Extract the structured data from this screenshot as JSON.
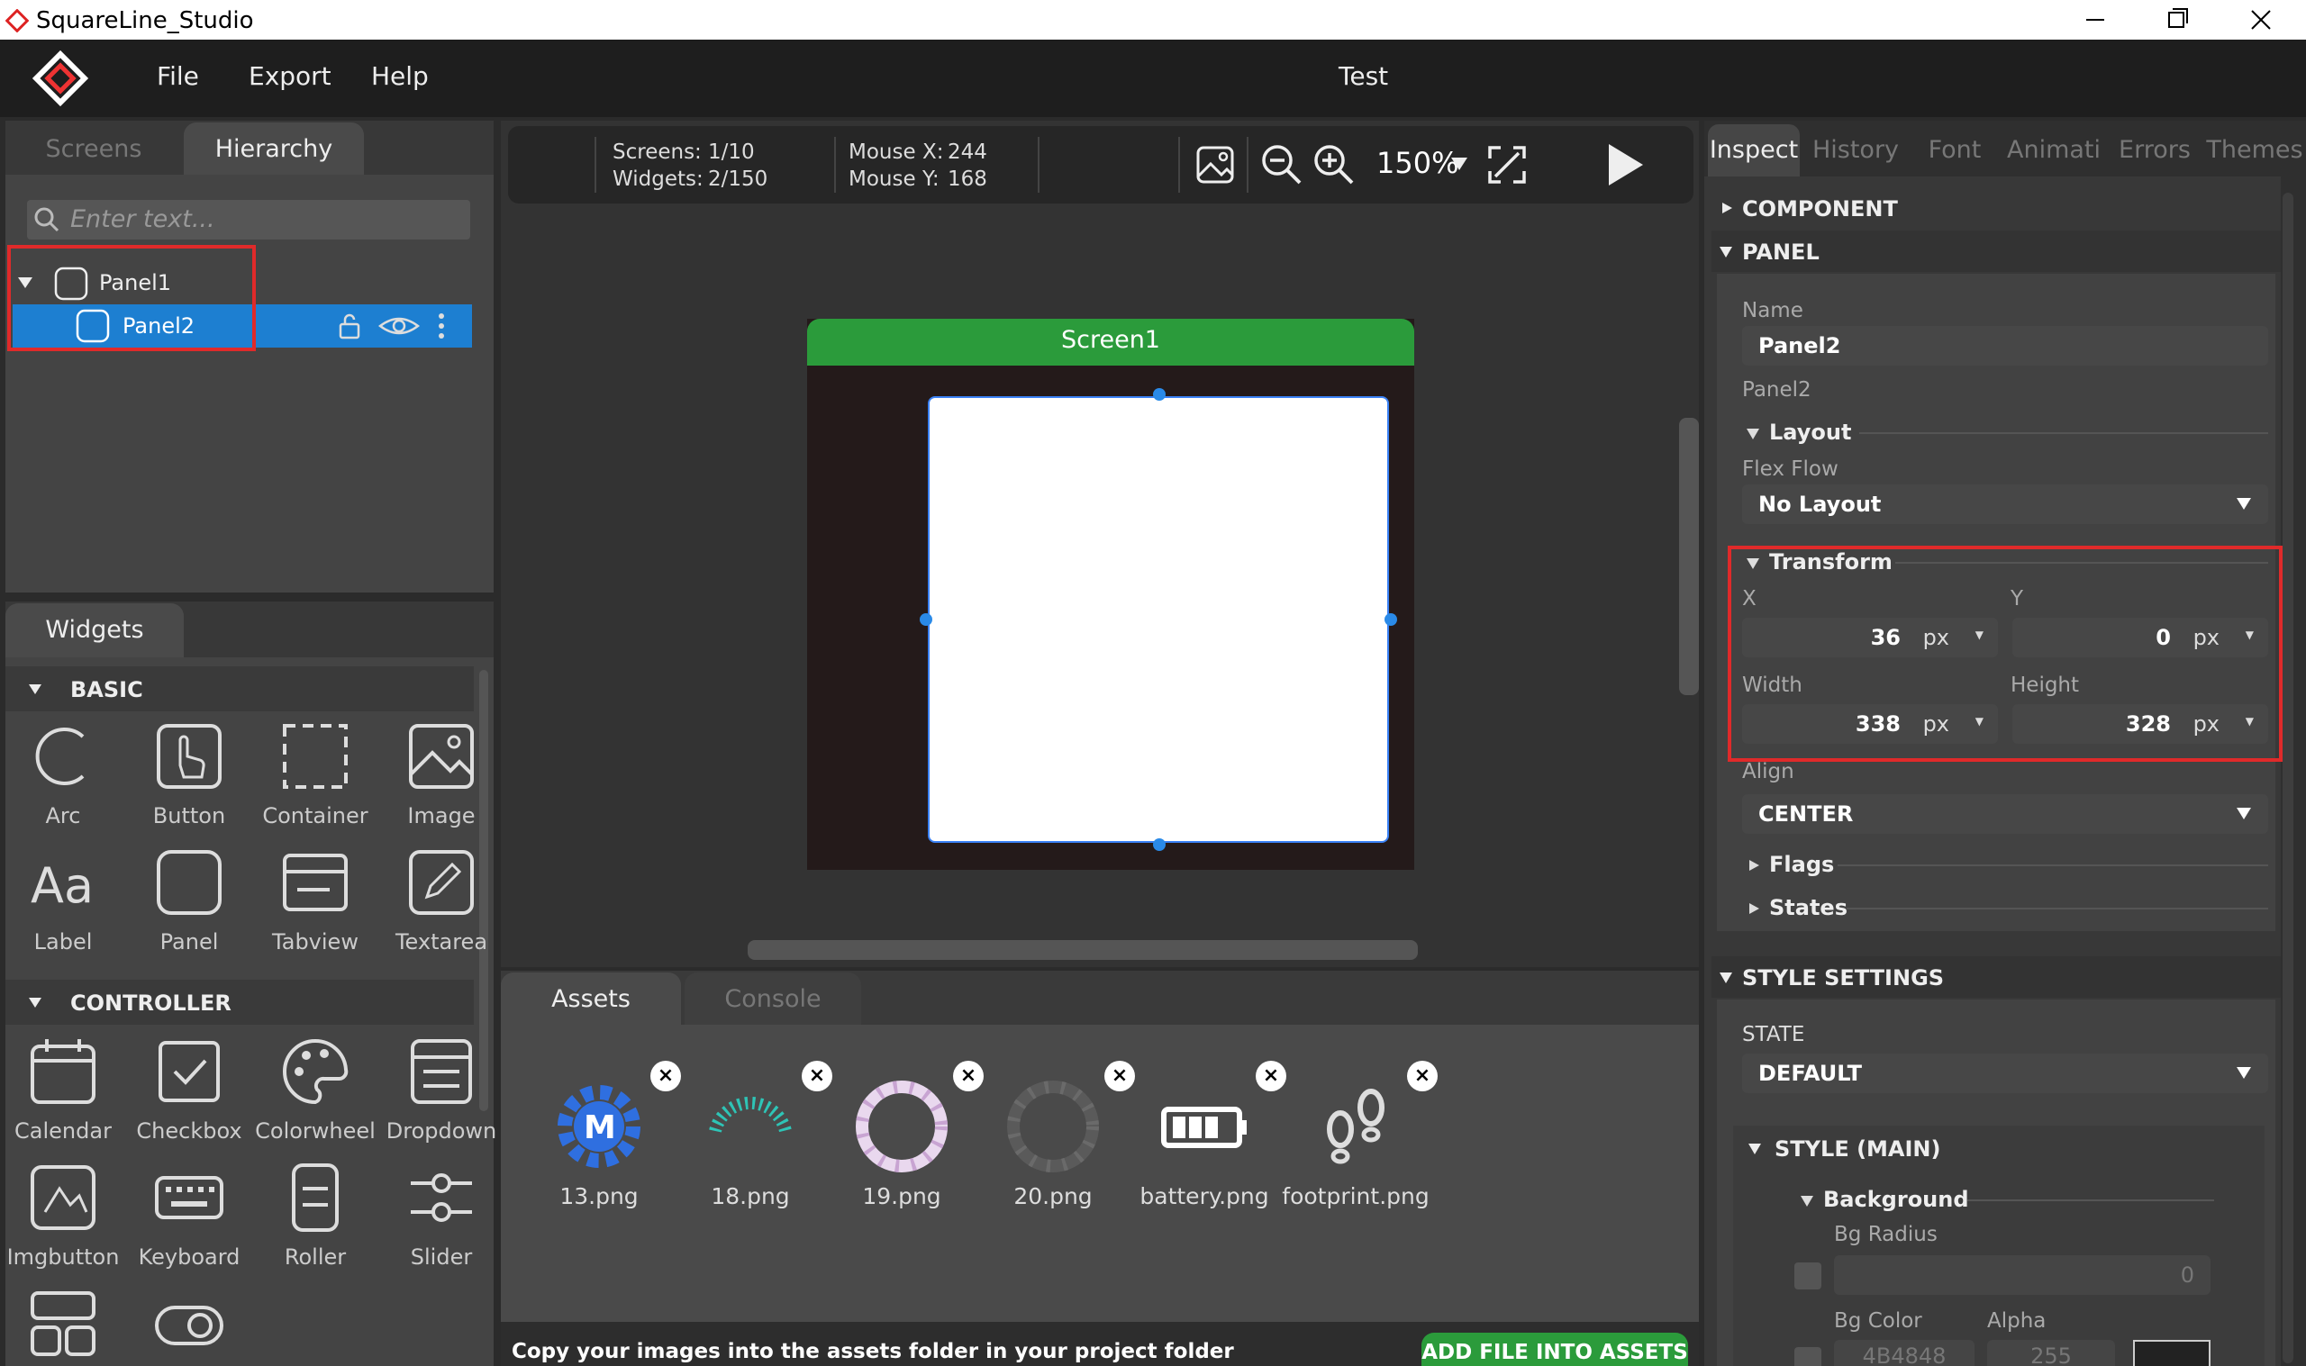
{
  "app": {
    "name": "SquareLine_Studio",
    "project_title": "Test"
  },
  "menu": [
    "File",
    "Export",
    "Help"
  ],
  "left_tabs": {
    "screens": "Screens",
    "hierarchy": "Hierarchy"
  },
  "search": {
    "placeholder": "Enter text..."
  },
  "tree": [
    {
      "label": "Panel1",
      "level": 0,
      "expanded": true,
      "selected": false
    },
    {
      "label": "Panel2",
      "level": 1,
      "expanded": false,
      "selected": true
    }
  ],
  "widgets": {
    "tab": "Widgets",
    "sections": [
      {
        "title": "BASIC",
        "items": [
          {
            "label": "Arc",
            "icon": "arc-icon"
          },
          {
            "label": "Button",
            "icon": "button-icon"
          },
          {
            "label": "Container",
            "icon": "container-icon"
          },
          {
            "label": "Image",
            "icon": "image-icon"
          },
          {
            "label": "Label",
            "icon": "label-icon"
          },
          {
            "label": "Panel",
            "icon": "panel-icon"
          },
          {
            "label": "Tabview",
            "icon": "tabview-icon"
          },
          {
            "label": "Textarea",
            "icon": "textarea-icon"
          }
        ]
      },
      {
        "title": "CONTROLLER",
        "items": [
          {
            "label": "Calendar",
            "icon": "calendar-icon"
          },
          {
            "label": "Checkbox",
            "icon": "checkbox-icon"
          },
          {
            "label": "Colorwheel",
            "icon": "colorwheel-icon"
          },
          {
            "label": "Dropdown",
            "icon": "dropdown-icon"
          },
          {
            "label": "Imgbutton",
            "icon": "imgbutton-icon"
          },
          {
            "label": "Keyboard",
            "icon": "keyboard-icon"
          },
          {
            "label": "Roller",
            "icon": "roller-icon"
          },
          {
            "label": "Slider",
            "icon": "slider-icon"
          }
        ]
      }
    ]
  },
  "toolbar": {
    "screens_label": "Screens:",
    "screens_value": "1/10",
    "widgets_label": "Widgets:",
    "widgets_value": "2/150",
    "mouse_x_label": "Mouse X:",
    "mouse_x_value": "244",
    "mouse_y_label": "Mouse Y:",
    "mouse_y_value": "168",
    "zoom": "150%"
  },
  "canvas": {
    "screen_title": "Screen1"
  },
  "bottom_tabs": {
    "assets": "Assets",
    "console": "Console"
  },
  "assets": [
    {
      "name": "13.png",
      "icon": "gear-m-icon"
    },
    {
      "name": "18.png",
      "icon": "gauge-arc-icon"
    },
    {
      "name": "19.png",
      "icon": "ring-white-icon"
    },
    {
      "name": "20.png",
      "icon": "ring-gray-icon"
    },
    {
      "name": "battery.png",
      "icon": "battery-icon"
    },
    {
      "name": "footprint.png",
      "icon": "footprint-icon"
    }
  ],
  "assets_footer": {
    "hint": "Copy your images into the assets folder in your project folder",
    "add_button": "ADD FILE INTO ASSETS"
  },
  "right_tabs": [
    "Inspect",
    "History",
    "Font",
    "Animati",
    "Errors",
    "Themes"
  ],
  "inspect": {
    "component": "COMPONENT",
    "panel": "PANEL",
    "name_label": "Name",
    "name_value": "Panel2",
    "type_label": "Panel2",
    "layout_title": "Layout",
    "flex_flow_label": "Flex Flow",
    "flex_flow_value": "No Layout",
    "transform_title": "Transform",
    "x_label": "X",
    "x_value": "36",
    "y_label": "Y",
    "y_value": "0",
    "width_label": "Width",
    "width_value": "338",
    "height_label": "Height",
    "height_value": "328",
    "unit": "px",
    "align_label": "Align",
    "align_value": "CENTER",
    "flags_title": "Flags",
    "states_title": "States",
    "style_settings": "STYLE SETTINGS",
    "state_label": "STATE",
    "state_value": "DEFAULT",
    "style_main": "STYLE (MAIN)",
    "background_title": "Background",
    "bg_radius_label": "Bg Radius",
    "bg_radius_value": "0",
    "bg_color_label": "Bg Color",
    "alpha_label": "Alpha",
    "bg_color_value": "4B4848",
    "alpha_value": "255"
  }
}
